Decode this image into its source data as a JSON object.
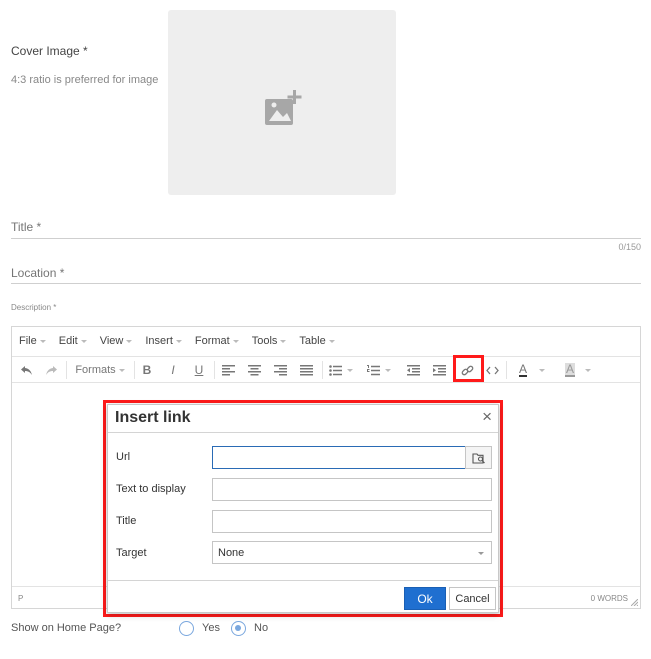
{
  "cover": {
    "label": "Cover Image *",
    "hint": "4:3 ratio is preferred for image",
    "icon": "add-photo-icon"
  },
  "title_field": {
    "placeholder": "Title *",
    "counter": "0/150"
  },
  "location_field": {
    "placeholder": "Location *"
  },
  "description": {
    "label": "Description *"
  },
  "editor": {
    "menu": [
      "File",
      "Edit",
      "View",
      "Insert",
      "Format",
      "Tools",
      "Table"
    ],
    "formats_label": "Formats",
    "bold": "B",
    "italic": "I",
    "underline": "U",
    "text_color_glyph": "A",
    "bg_color_glyph": "A",
    "status_path": "P",
    "word_count": "0 WORDS"
  },
  "dialog": {
    "title": "Insert link",
    "close": "×",
    "fields": {
      "url": {
        "label": "Url",
        "value": ""
      },
      "text": {
        "label": "Text to display",
        "value": ""
      },
      "title": {
        "label": "Title",
        "value": ""
      },
      "target": {
        "label": "Target",
        "value": "None"
      }
    },
    "ok": "Ok",
    "cancel": "Cancel"
  },
  "home_page": {
    "label": "Show on Home Page?",
    "options": [
      "Yes",
      "No"
    ],
    "selected": "No"
  },
  "colors": {
    "highlight": "#ff1a1a",
    "primary": "#1f6fd0",
    "radio": "#7aa7de"
  }
}
